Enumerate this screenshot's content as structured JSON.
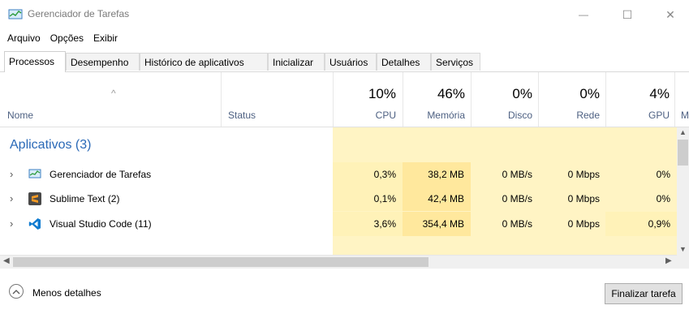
{
  "window": {
    "title": "Gerenciador de Tarefas",
    "controls": {
      "minimize": "—",
      "maximize": "☐",
      "close": "✕"
    }
  },
  "menu": [
    "Arquivo",
    "Opções",
    "Exibir"
  ],
  "tabs": [
    "Processos",
    "Desempenho",
    "Histórico de aplicativos",
    "Inicializar",
    "Usuários",
    "Detalhes",
    "Serviços"
  ],
  "active_tab": "Processos",
  "columns": {
    "name": "Nome",
    "status": "Status",
    "cpu": {
      "pct": "10%",
      "label": "CPU"
    },
    "memory": {
      "pct": "46%",
      "label": "Memória"
    },
    "disk": {
      "pct": "0%",
      "label": "Disco"
    },
    "network": {
      "pct": "0%",
      "label": "Rede"
    },
    "gpu": {
      "pct": "4%",
      "label": "GPU"
    },
    "next_col": "M",
    "sort_glyph": "^"
  },
  "group": {
    "label": "Aplicativos (3)"
  },
  "processes": [
    {
      "name": "Gerenciador de Tarefas",
      "icon": "task-manager-icon",
      "cpu": "0,3%",
      "memory": "38,2 MB",
      "disk": "0 MB/s",
      "network": "0 Mbps",
      "gpu": "0%"
    },
    {
      "name": "Sublime Text (2)",
      "icon": "sublime-text-icon",
      "cpu": "0,1%",
      "memory": "42,4 MB",
      "disk": "0 MB/s",
      "network": "0 Mbps",
      "gpu": "0%"
    },
    {
      "name": "Visual Studio Code (11)",
      "icon": "vscode-icon",
      "cpu": "3,6%",
      "memory": "354,4 MB",
      "disk": "0 MB/s",
      "network": "0 Mbps",
      "gpu": "0,9%"
    }
  ],
  "footer": {
    "less_details": "Menos detalhes",
    "end_task": "Finalizar tarefa"
  },
  "colors": {
    "accent": "#2a69b7",
    "heat_light": "#fff4c4",
    "heat_mid": "#fff2b8",
    "heat_strong": "#ffe89d"
  }
}
